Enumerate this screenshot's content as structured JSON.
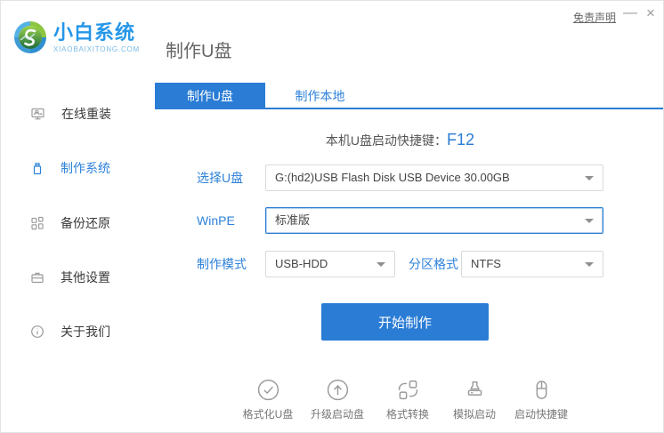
{
  "window": {
    "brand_name": "小白系统",
    "brand_domain": "XIAOBAIXITONG.COM",
    "page_title": "制作U盘",
    "disclaimer_link": "免责声明",
    "minimize_glyph": "—",
    "close_glyph": "×"
  },
  "sidebar": {
    "items": [
      {
        "label": "在线重装",
        "icon": "monitor-reinstall-icon",
        "active": false
      },
      {
        "label": "制作系统",
        "icon": "usb-drive-icon",
        "active": true
      },
      {
        "label": "备份还原",
        "icon": "backup-restore-icon",
        "active": false
      },
      {
        "label": "其他设置",
        "icon": "settings-case-icon",
        "active": false
      },
      {
        "label": "关于我们",
        "icon": "info-icon",
        "active": false
      }
    ]
  },
  "tabs": [
    {
      "label": "制作U盘",
      "active": true
    },
    {
      "label": "制作本地",
      "active": false
    }
  ],
  "main": {
    "boot_key_label": "本机U盘启动快捷键：",
    "boot_key_value": "F12",
    "fields": {
      "usb_select": {
        "label": "选择U盘",
        "value": "G:(hd2)USB Flash Disk USB Device 30.00GB"
      },
      "winpe": {
        "label": "WinPE",
        "value": "标准版"
      },
      "make_mode": {
        "label": "制作模式",
        "value": "USB-HDD"
      },
      "partition_format": {
        "label": "分区格式",
        "value": "NTFS"
      }
    },
    "start_button": "开始制作"
  },
  "footer_tools": [
    {
      "label": "格式化U盘",
      "icon": "format-usb-icon"
    },
    {
      "label": "升级启动盘",
      "icon": "upgrade-boot-icon"
    },
    {
      "label": "格式转换",
      "icon": "format-convert-icon"
    },
    {
      "label": "模拟启动",
      "icon": "simulate-boot-icon"
    },
    {
      "label": "启动快捷键",
      "icon": "boot-hotkey-icon"
    }
  ],
  "colors": {
    "primary_blue": "#2a7cd5",
    "label_blue": "#2e82d9",
    "brand_blue": "#2496e8",
    "icon_gray": "#9b9b9b"
  }
}
